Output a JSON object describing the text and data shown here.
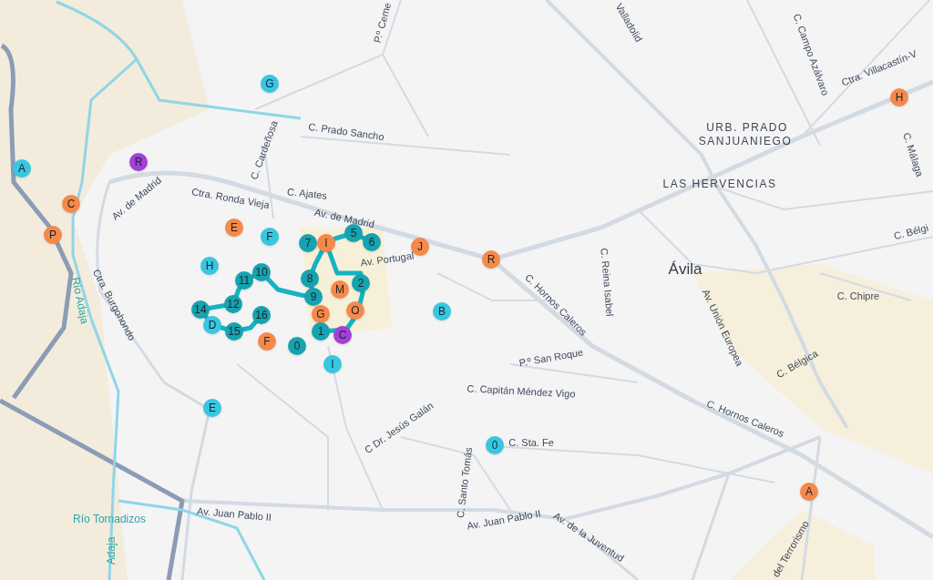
{
  "map": {
    "labels": [
      {
        "text": "P.º Ceme",
        "kind": "street"
      },
      {
        "text": "Valladolid",
        "kind": "street"
      },
      {
        "text": "C. Campo Azálvaro",
        "kind": "street"
      },
      {
        "text": "Ctra. Villacastín-V",
        "kind": "street"
      },
      {
        "text": "URB. PRADO",
        "kind": "district"
      },
      {
        "text": "SANJUANIEGO",
        "kind": "district"
      },
      {
        "text": "C. Málaga",
        "kind": "street"
      },
      {
        "text": "C. Prado Sancho",
        "kind": "street"
      },
      {
        "text": "C. Cardeñosa",
        "kind": "street"
      },
      {
        "text": "LAS HERVENCIAS",
        "kind": "district"
      },
      {
        "text": "Av. de Madrid",
        "kind": "street"
      },
      {
        "text": "Ctra. Ronda Vieja",
        "kind": "street"
      },
      {
        "text": "C. Ajates",
        "kind": "street"
      },
      {
        "text": "Av. de Madrid",
        "kind": "street"
      },
      {
        "text": "Av. Portugal",
        "kind": "street"
      },
      {
        "text": "C. Bélgi",
        "kind": "street"
      },
      {
        "text": "Ávila",
        "kind": "city"
      },
      {
        "text": "Río Adaja",
        "kind": "river"
      },
      {
        "text": "Ctra. Burgohondo",
        "kind": "street"
      },
      {
        "text": "C. Hornos Caleros",
        "kind": "street"
      },
      {
        "text": "C. Reina Isabel",
        "kind": "street"
      },
      {
        "text": "Av. Unión Europea",
        "kind": "street"
      },
      {
        "text": "C. Chipre",
        "kind": "street"
      },
      {
        "text": "P.º San Roque",
        "kind": "street"
      },
      {
        "text": "C. Bélgica",
        "kind": "street"
      },
      {
        "text": "C. Capitán Méndez Vigo",
        "kind": "street"
      },
      {
        "text": "C. Hornos Caleros",
        "kind": "street"
      },
      {
        "text": "C Dr. Jesús Galán",
        "kind": "street"
      },
      {
        "text": "C. Sta. Fe",
        "kind": "street"
      },
      {
        "text": "C. Santo Tomás",
        "kind": "street"
      },
      {
        "text": "Río Tornadizos",
        "kind": "river"
      },
      {
        "text": "Av. Juan Pablo II",
        "kind": "street"
      },
      {
        "text": "Av. Juan Pablo II",
        "kind": "street"
      },
      {
        "text": "Av. de la Juventud",
        "kind": "street"
      },
      {
        "text": "del Terrorismo",
        "kind": "street"
      },
      {
        "text": "Adaja",
        "kind": "river"
      }
    ],
    "markers": [
      {
        "label": "G",
        "color": "#38c6e0"
      },
      {
        "label": "A",
        "color": "#38c6e0"
      },
      {
        "label": "R",
        "color": "#a43fd8"
      },
      {
        "label": "C",
        "color": "#f5894a"
      },
      {
        "label": "P",
        "color": "#f5894a"
      },
      {
        "label": "E",
        "color": "#f5894a"
      },
      {
        "label": "F",
        "color": "#38c6e0"
      },
      {
        "label": "H",
        "color": "#38c6e0"
      },
      {
        "label": "J",
        "color": "#f5894a"
      },
      {
        "label": "R",
        "color": "#f5894a"
      },
      {
        "label": "H",
        "color": "#f5894a"
      },
      {
        "label": "7",
        "color": "#15a3b0"
      },
      {
        "label": "I",
        "color": "#f5894a"
      },
      {
        "label": "5",
        "color": "#15a3b0"
      },
      {
        "label": "6",
        "color": "#15a3b0"
      },
      {
        "label": "8",
        "color": "#15a3b0"
      },
      {
        "label": "9",
        "color": "#15a3b0"
      },
      {
        "label": "M",
        "color": "#f5894a"
      },
      {
        "label": "2",
        "color": "#15a3b0"
      },
      {
        "label": "10",
        "color": "#15a3b0"
      },
      {
        "label": "11",
        "color": "#15a3b0"
      },
      {
        "label": "12",
        "color": "#15a3b0"
      },
      {
        "label": "14",
        "color": "#15a3b0"
      },
      {
        "label": "16",
        "color": "#15a3b0"
      },
      {
        "label": "D",
        "color": "#38c6e0"
      },
      {
        "label": "15",
        "color": "#15a3b0"
      },
      {
        "label": "G",
        "color": "#f5894a"
      },
      {
        "label": "O",
        "color": "#f5894a"
      },
      {
        "label": "1",
        "color": "#15a3b0"
      },
      {
        "label": "C",
        "color": "#a43fd8"
      },
      {
        "label": "F",
        "color": "#f5894a"
      },
      {
        "label": "0",
        "color": "#15a3b0"
      },
      {
        "label": "B",
        "color": "#38c6e0"
      },
      {
        "label": "I",
        "color": "#38c6e0"
      },
      {
        "label": "E",
        "color": "#38c6e0"
      },
      {
        "label": "0",
        "color": "#38c6e0"
      },
      {
        "label": "A",
        "color": "#f5894a"
      }
    ]
  }
}
